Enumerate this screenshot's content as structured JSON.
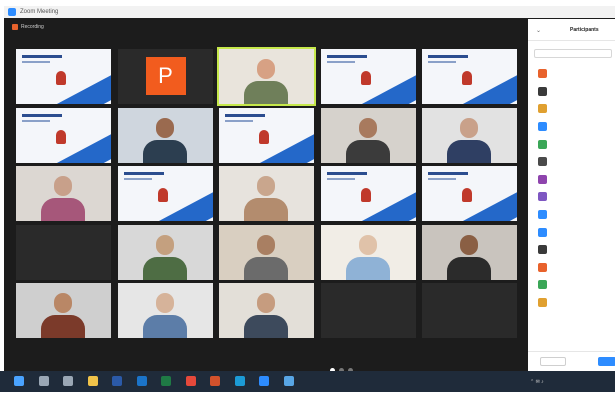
{
  "window": {
    "title": "Zoom Meeting"
  },
  "recording": {
    "label": "Recording"
  },
  "gallery": {
    "tiles": [
      {
        "kind": "slide",
        "name": ""
      },
      {
        "kind": "avatar",
        "letter": "P",
        "name": ""
      },
      {
        "kind": "person",
        "name": "",
        "skin": "#d7a184",
        "shirt": "#6f7f5a",
        "bg": "#e9e4dc",
        "active": true
      },
      {
        "kind": "slide",
        "name": ""
      },
      {
        "kind": "slide",
        "name": ""
      },
      {
        "kind": "slide",
        "name": ""
      },
      {
        "kind": "person",
        "name": "",
        "skin": "#9a6a4f",
        "shirt": "#2c3e50",
        "bg": "#cfd6de"
      },
      {
        "kind": "slide",
        "name": ""
      },
      {
        "kind": "person",
        "name": "",
        "skin": "#a87a5e",
        "shirt": "#3b3b3b",
        "bg": "#d6d2cc"
      },
      {
        "kind": "person",
        "name": "",
        "skin": "#c9a18a",
        "shirt": "#2f3f63",
        "bg": "#e2e2e2"
      },
      {
        "kind": "person",
        "name": "",
        "skin": "#c8a08a",
        "shirt": "#a6577a",
        "bg": "#dcd7d2"
      },
      {
        "kind": "slide",
        "name": ""
      },
      {
        "kind": "person",
        "name": "",
        "skin": "#c9a68d",
        "shirt": "#b38c6e",
        "bg": "#e7e3dd"
      },
      {
        "kind": "slide",
        "name": ""
      },
      {
        "kind": "slide",
        "name": ""
      },
      {
        "kind": "empty",
        "name": ""
      },
      {
        "kind": "person",
        "name": "",
        "skin": "#c4a07f",
        "shirt": "#4e6d44",
        "bg": "#d8d8d8"
      },
      {
        "kind": "person",
        "name": "",
        "skin": "#a97f62",
        "shirt": "#6b6b6b",
        "bg": "#d9cfc1"
      },
      {
        "kind": "person",
        "name": "",
        "skin": "#e0c2a9",
        "shirt": "#8fb2d6",
        "bg": "#f1ede6"
      },
      {
        "kind": "person",
        "name": "",
        "skin": "#8a5f44",
        "shirt": "#2b2b2b",
        "bg": "#c9c4be"
      },
      {
        "kind": "person",
        "name": "",
        "skin": "#b98766",
        "shirt": "#7b3a2a",
        "bg": "#cfcfcf"
      },
      {
        "kind": "person",
        "name": "",
        "skin": "#d6b39a",
        "shirt": "#5c7da8",
        "bg": "#e6e6e6"
      },
      {
        "kind": "person",
        "name": "",
        "skin": "#c69c7f",
        "shirt": "#3d4a5c",
        "bg": "#e3dfd8"
      },
      {
        "kind": "empty",
        "name": ""
      },
      {
        "kind": "text",
        "text": "",
        "name": ""
      }
    ]
  },
  "participants_panel": {
    "title": "Participants",
    "search_placeholder": "",
    "items": [
      {
        "name": "",
        "color": "#e8622c"
      },
      {
        "name": "",
        "color": "#3a3a3a"
      },
      {
        "name": "",
        "color": "#e0a030"
      },
      {
        "name": "",
        "color": "#2d8cff"
      },
      {
        "name": "",
        "color": "#3aa657"
      },
      {
        "name": "",
        "color": "#4a4a4a"
      },
      {
        "name": "",
        "color": "#8e44ad"
      },
      {
        "name": "",
        "color": "#7e57c2"
      },
      {
        "name": "",
        "color": "#2d8cff"
      },
      {
        "name": "",
        "color": "#2d8cff"
      },
      {
        "name": "",
        "color": "#3a3a3a"
      },
      {
        "name": "",
        "color": "#e8622c"
      },
      {
        "name": "",
        "color": "#3aa657"
      },
      {
        "name": "",
        "color": "#e0a030"
      }
    ],
    "invite_label": "",
    "blue_button_label": ""
  },
  "taskbar": {
    "icons": [
      {
        "name": "start-icon",
        "color": "#4aa3ff"
      },
      {
        "name": "search-icon",
        "color": "#9aa7b5"
      },
      {
        "name": "task-view-icon",
        "color": "#9aa7b5"
      },
      {
        "name": "explorer-icon",
        "color": "#f0c34a"
      },
      {
        "name": "word-icon",
        "color": "#2b5aa8"
      },
      {
        "name": "outlook-icon",
        "color": "#1b74c9"
      },
      {
        "name": "excel-icon",
        "color": "#1f7a45"
      },
      {
        "name": "chrome-icon",
        "color": "#e5493b"
      },
      {
        "name": "powerpoint-icon",
        "color": "#d2522c"
      },
      {
        "name": "edge-icon",
        "color": "#1c9bd6"
      },
      {
        "name": "zoom-icon",
        "color": "#2d8cff"
      },
      {
        "name": "store-icon",
        "color": "#58a6e6"
      }
    ]
  }
}
